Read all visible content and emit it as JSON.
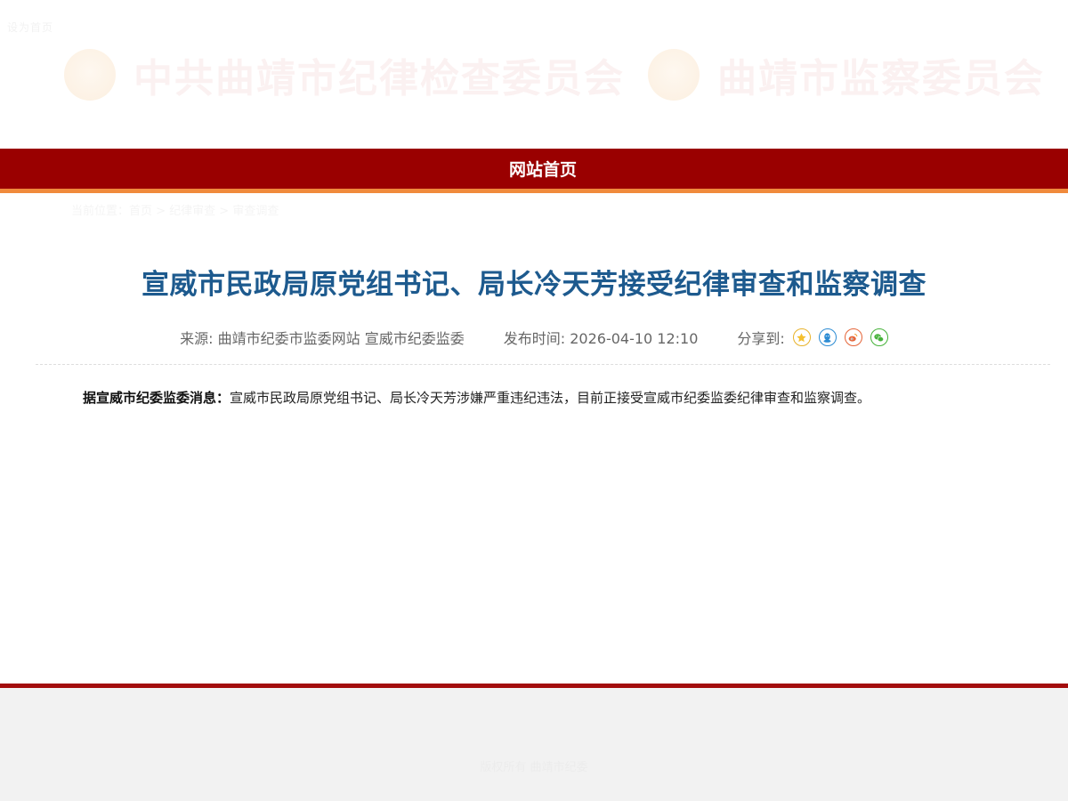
{
  "header": {
    "topline": "设为首页",
    "logo_left": "中共曲靖市纪律检查委员会",
    "logo_right": "曲靖市监察委员会"
  },
  "nav": {
    "home": "网站首页"
  },
  "breadcrumb": "当前位置：首页 > 纪律审查 > 审查调查",
  "article": {
    "title": "宣威市民政局原党组书记、局长冷天芳接受纪律审查和监察调查",
    "source": "来源: 曲靖市纪委市监委网站 宣威市纪委监委",
    "publish_time": "发布时间: 2026-04-10 12:10",
    "share_label": "分享到:",
    "share_icons": [
      "favorite-star-icon",
      "qq-icon",
      "weibo-icon",
      "wechat-icon"
    ],
    "body_lead": "据宣威市纪委监委消息：",
    "body_text": "宣威市民政局原党组书记、局长冷天芳涉嫌严重违纪违法，目前正接受宣威市纪委监委纪律审查和监察调查。"
  },
  "footer": {
    "text": "版权所有 曲靖市纪委"
  },
  "colors": {
    "nav_bg": "#9a0000",
    "nav_underline": "#f08a3c",
    "title": "#1d5a8e",
    "footer_line": "#a30d0d"
  }
}
